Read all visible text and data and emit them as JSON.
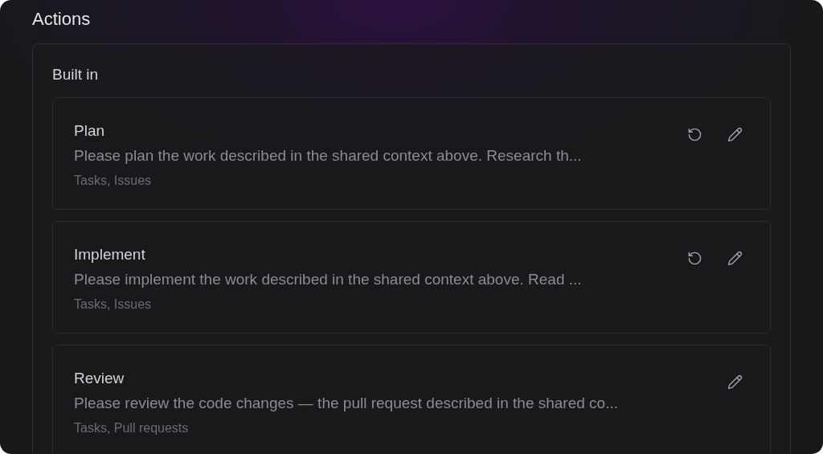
{
  "title": "Actions",
  "section": {
    "heading": "Built in",
    "actions": [
      {
        "name": "Plan",
        "prompt": "Please plan the work described in the shared context above. Research th...",
        "tags": "Tasks, Issues",
        "resettable": true
      },
      {
        "name": "Implement",
        "prompt": "Please implement the work described in the shared context above. Read ...",
        "tags": "Tasks, Issues",
        "resettable": true
      },
      {
        "name": "Review",
        "prompt": "Please review the code changes — the pull request described in the shared co...",
        "tags": "Tasks, Pull requests",
        "resettable": false
      }
    ]
  }
}
